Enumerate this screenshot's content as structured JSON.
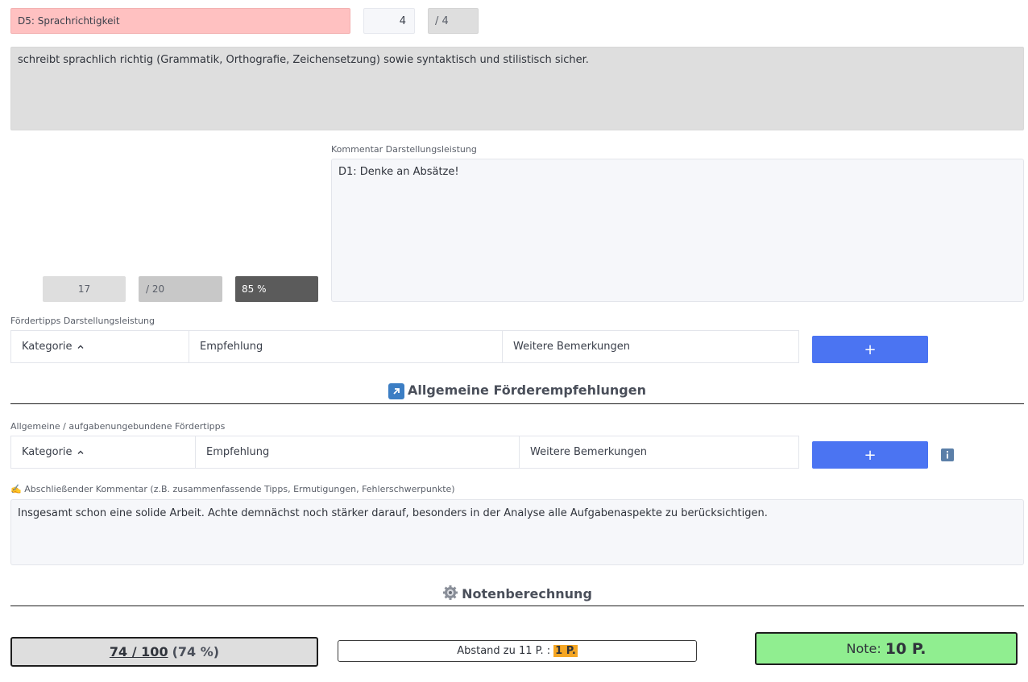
{
  "criterion": {
    "title": "D5: Sprachrichtigkeit",
    "score": "4",
    "max": "/ 4",
    "description": "schreibt sprachlich richtig (Grammatik, Orthografie, Zeichensetzung) sowie syntaktisch und stilistisch sicher."
  },
  "presentation": {
    "comment_label": "Kommentar Darstellungsleistung",
    "comment_text": "D1: Denke an Absätze!",
    "sum_score": "17",
    "sum_max": "/ 20",
    "sum_percent": "85 %",
    "tips_label": "Fördertipps Darstellungsleistung",
    "tips_columns": [
      "Kategorie",
      "Empfehlung",
      "Weitere Bemerkungen"
    ],
    "sort_icon": "chevron-up",
    "add_label": "+"
  },
  "general": {
    "section_title": "Allgemeine Förderempfehlungen",
    "section_icon": "arrow-up-right-icon",
    "tips_label": "Allgemeine / aufgabenungebundene Fördertipps",
    "tips_columns": [
      "Kategorie",
      "Empfehlung",
      "Weitere Bemerkungen"
    ],
    "add_label": "+",
    "info_icon": "info-icon"
  },
  "final_comment": {
    "label_icon": "✍️",
    "label": "Abschließender Kommentar (z.B. zusammenfassende Tipps, Ermutigungen, Fehlerschwerpunkte)",
    "text": "Insgesamt schon eine solide Arbeit. Achte demnächst noch stärker darauf, besonders in der Analyse alle Aufgabenaspekte zu berücksichtigen."
  },
  "grading": {
    "section_title": "Notenberechnung",
    "section_icon": "gear-icon",
    "total": "74 / 100",
    "total_percent": "(74 %)",
    "gap_label": "Abstand zu 11 P. :",
    "gap_value": "1 P.",
    "grade_label": "Note:",
    "grade_value": "10 P."
  },
  "colors": {
    "criterion_bg": "#ffc1c1",
    "add_button": "#4b74f2",
    "grade_bg": "#90ee90",
    "gap_highlight": "#f5a623"
  }
}
